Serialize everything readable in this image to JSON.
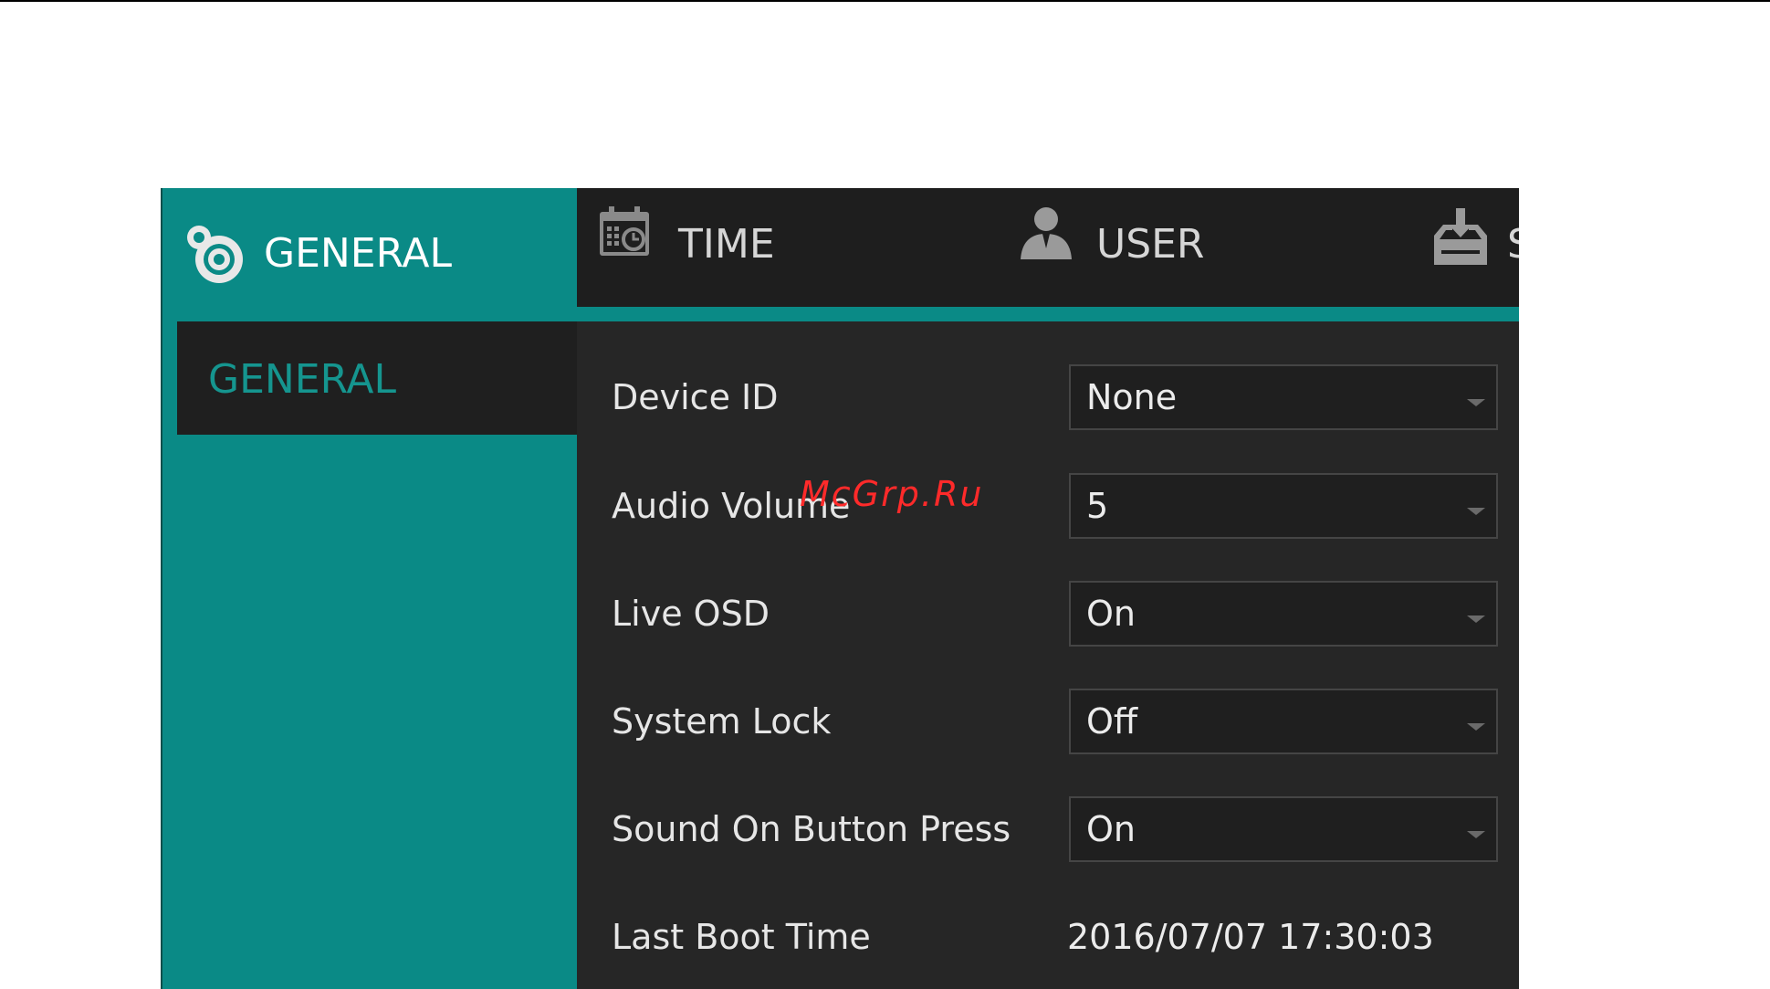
{
  "sidebar": {
    "title": "GENERAL",
    "icon": "gear-icon",
    "items": [
      {
        "label": "GENERAL",
        "active": true
      }
    ]
  },
  "tabs": [
    {
      "label": "TIME",
      "icon": "calendar-clock-icon"
    },
    {
      "label": "USER",
      "icon": "user-icon"
    },
    {
      "label": "S",
      "icon": "storage-icon"
    }
  ],
  "settings": {
    "device_id": {
      "label": "Device ID",
      "value": "None"
    },
    "audio_volume": {
      "label": "Audio Volume",
      "value": "5"
    },
    "live_osd": {
      "label": "Live OSD",
      "value": "On"
    },
    "system_lock": {
      "label": "System Lock",
      "value": "Off"
    },
    "sound_on_button_press": {
      "label": "Sound On Button Press",
      "value": "On"
    },
    "last_boot_time": {
      "label": "Last Boot Time",
      "value": "2016/07/07 17:30:03"
    }
  },
  "watermark": "McGrp.Ru",
  "colors": {
    "accent": "#0a8a86",
    "panel": "#262626",
    "header": "#1e1e1e",
    "watermark": "#ff2a2a"
  }
}
